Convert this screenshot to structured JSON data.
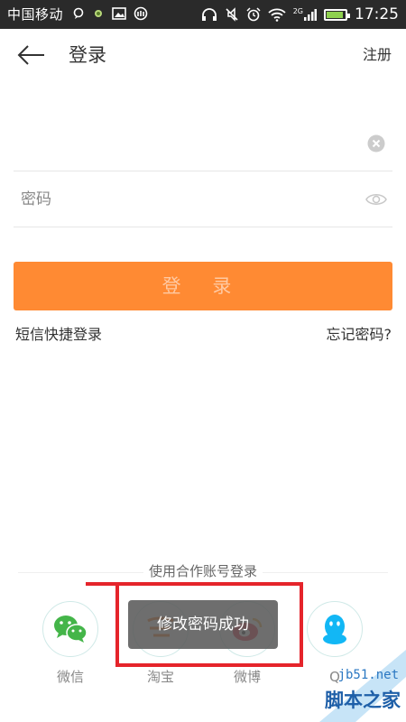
{
  "status_bar": {
    "carrier": "中国移动",
    "network_badge": "2G",
    "time": "17:25",
    "battery_level": 0.8,
    "colors": {
      "background": "#2a2a2a",
      "text": "#ffffff",
      "battery": "#8fd14f"
    }
  },
  "header": {
    "back_icon": "arrow-left-icon",
    "title": "登录",
    "register_label": "注册"
  },
  "form": {
    "account": {
      "value": "",
      "placeholder": "",
      "clear_icon": "clear-icon"
    },
    "password": {
      "value": "",
      "placeholder": "密码",
      "toggle_icon": "eye-icon"
    },
    "login_label": "登 录",
    "sms_login_label": "短信快捷登录",
    "forgot_password_label": "忘记密码?"
  },
  "partners": {
    "title": "使用合作账号登录",
    "items": [
      {
        "label": "微信",
        "icon": "wechat-icon"
      },
      {
        "label": "淘宝",
        "icon": "taobao-icon"
      },
      {
        "label": "微博",
        "icon": "weibo-icon"
      },
      {
        "label": "Q",
        "icon": "qq-icon"
      }
    ]
  },
  "toast": {
    "message": "修改密码成功"
  },
  "watermark": {
    "site": "jb51.net",
    "name": "脚本之家"
  },
  "colors": {
    "accent": "#ff8a33",
    "annotation": "#e5242b"
  }
}
